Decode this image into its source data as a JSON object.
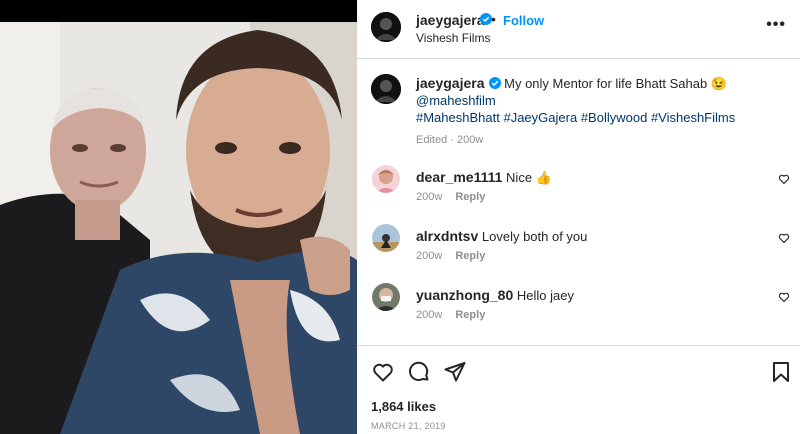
{
  "post": {
    "username": "jaeygajera",
    "follow_label": "Follow",
    "separator": "•",
    "subtitle": "Vishesh Films",
    "more_label": "•••",
    "caption": {
      "username": "jaeygajera",
      "text": "My only Mentor for life Bhatt Sahab",
      "emoji": "😉",
      "mention": "@maheshfilm",
      "hashtags": [
        "#MaheshBhatt",
        "#JaeyGajera",
        "#Bollywood",
        "#VisheshFilms"
      ],
      "meta": "Edited · 200w"
    },
    "comments": [
      {
        "username": "dear_me1111",
        "text": "Nice 👍",
        "age": "200w",
        "reply_label": "Reply"
      },
      {
        "username": "alrxdntsv",
        "text": "Lovely both of you",
        "age": "200w",
        "reply_label": "Reply"
      },
      {
        "username": "yuanzhong_80",
        "text": "Hello jaey",
        "age": "200w",
        "reply_label": "Reply"
      }
    ],
    "likes": "1,864 likes",
    "date": "MARCH 21, 2019"
  },
  "colors": {
    "link": "#00376b",
    "follow": "#0095f6",
    "verified": "#0095f6",
    "muted": "#8e8e8e",
    "text": "#262626"
  },
  "icons": {
    "header": [
      "verified-badge-icon",
      "more-options-icon"
    ],
    "actions": [
      "heart-icon",
      "comment-icon",
      "share-icon",
      "bookmark-icon"
    ]
  }
}
